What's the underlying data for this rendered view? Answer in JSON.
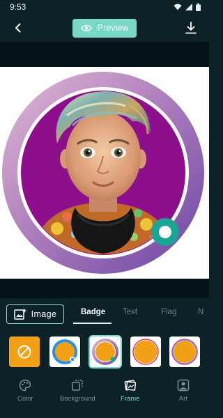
{
  "status": {
    "time": "9:53"
  },
  "topbar": {
    "preview_label": "Preview"
  },
  "toolbar": {
    "image_label": "Image"
  },
  "tabs": [
    {
      "label": "Badge",
      "active": true
    },
    {
      "label": "Text",
      "active": false
    },
    {
      "label": "Flag",
      "active": false
    },
    {
      "label": "N",
      "active": false
    }
  ],
  "frames": [
    {
      "name": "none",
      "selected": false
    },
    {
      "name": "blue-ring",
      "selected": false
    },
    {
      "name": "rainbow-ring",
      "selected": true
    },
    {
      "name": "thin-ring",
      "selected": false
    },
    {
      "name": "rainbow-ring-2",
      "selected": false
    }
  ],
  "bottom_nav": [
    {
      "label": "Color",
      "icon": "palette-icon",
      "active": false
    },
    {
      "label": "Background",
      "icon": "background-icon",
      "active": false
    },
    {
      "label": "Frame",
      "icon": "frame-icon",
      "active": true
    },
    {
      "label": "Art",
      "icon": "art-icon",
      "active": false
    }
  ],
  "colors": {
    "accent": "#7ad8c6",
    "background": "#0c2227",
    "frame_ring_start": "#d9b4cf",
    "frame_ring_end": "#7a4fa6",
    "photo_bg": "#8e0f8c",
    "badge": "#1aa596",
    "orange": "#f2a116"
  }
}
